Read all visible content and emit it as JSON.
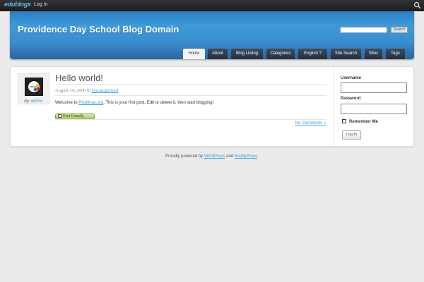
{
  "admin_bar": {
    "logo": "edublogs",
    "login_label": "Log In"
  },
  "header": {
    "site_title": "Providence Day School Blog Domain",
    "search_placeholder": "",
    "search_button": "Search"
  },
  "nav": {
    "tabs": [
      {
        "label": "Home",
        "active": true
      },
      {
        "label": "About"
      },
      {
        "label": "Blog Listing"
      },
      {
        "label": "Categories"
      },
      {
        "label": "English ?"
      },
      {
        "label": "Site Search"
      },
      {
        "label": "Sites"
      },
      {
        "label": "Tags"
      }
    ]
  },
  "post": {
    "title": "Hello world!",
    "date": "August 14, 2008 in ",
    "category": "Uncategorized",
    "author_prefix": "by ",
    "author": "admin",
    "avatar_text": "Steelers",
    "body_prefix": "Welcome to ",
    "body_link": "Pdsblogs.org",
    "body_suffix": ". This is your first post. Edit or delete it, then start blogging!",
    "print_friendly": "Print Friendly",
    "comments": "No Comments »"
  },
  "sidebar": {
    "username_label": "Username",
    "password_label": "Password",
    "remember_label": "Remember Me",
    "login_button": "Log In"
  },
  "footer": {
    "prefix": "Proudly powered by ",
    "link1": "WordPress",
    "middle": " and ",
    "link2": "BuddyPress",
    "suffix": "."
  },
  "colors": {
    "header_blue": "#3f9ad9",
    "link_blue": "#3a9fd6",
    "nav_dark": "#22303e"
  }
}
